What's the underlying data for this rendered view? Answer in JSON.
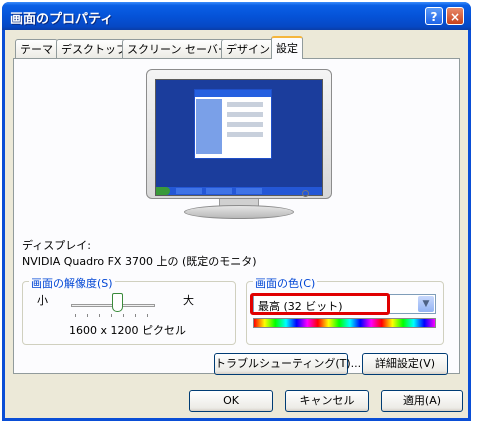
{
  "window": {
    "title": "画面のプロパティ",
    "help_label": "?",
    "close_label": "×"
  },
  "tabs": [
    {
      "label": "テーマ"
    },
    {
      "label": "デスクトップ"
    },
    {
      "label": "スクリーン セーバー"
    },
    {
      "label": "デザイン"
    },
    {
      "label": "設定",
      "active": true
    }
  ],
  "display": {
    "label": "ディスプレイ:",
    "device": "NVIDIA Quadro FX 3700 上の (既定のモニタ)"
  },
  "resolution": {
    "legend": "画面の解像度(S)",
    "less_label": "小",
    "more_label": "大",
    "value_text": "1600 x 1200 ピクセル",
    "slider_level": 0.55
  },
  "color_quality": {
    "legend": "画面の色(C)",
    "selected": "最高 (32 ビット)",
    "highlight_color": "#e00000"
  },
  "buttons": {
    "troubleshoot": "トラブルシューティング(T)...",
    "advanced": "詳細設定(V)",
    "ok": "OK",
    "cancel": "キャンセル",
    "apply": "適用(A)"
  },
  "colors": {
    "titlebar": "#0553d8",
    "legend": "#0046d5",
    "face": "#ece9d8"
  }
}
